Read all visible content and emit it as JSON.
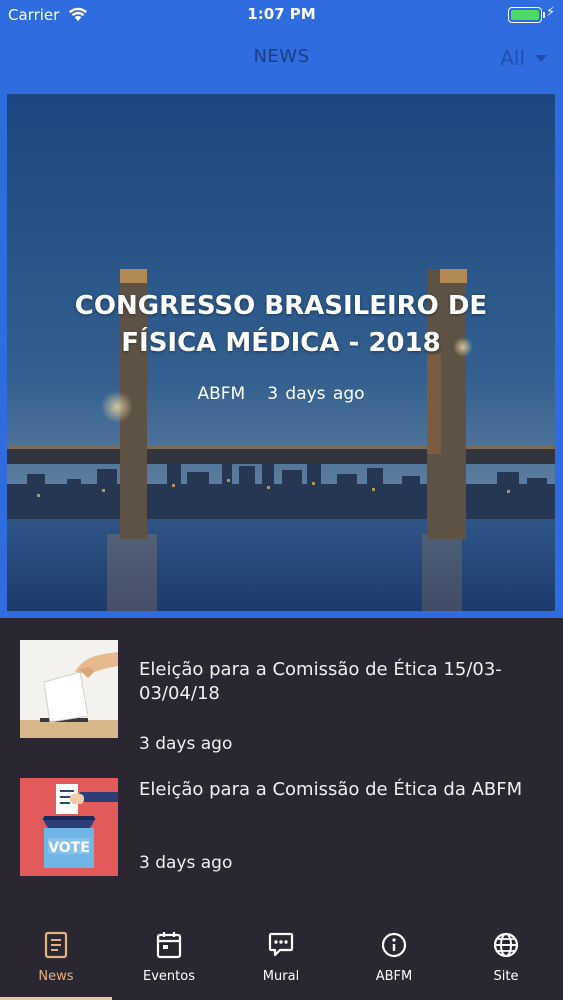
{
  "status": {
    "carrier": "Carrier",
    "time": "1:07 PM"
  },
  "header": {
    "title": "NEWS",
    "filter_label": "All"
  },
  "featured": {
    "title": "CONGRESSO BRASILEIRO DE FÍSICA MÉDICA - 2018",
    "source": "ABFM",
    "time": "3 days ago"
  },
  "news": [
    {
      "title": "Eleição para a Comissão de Ética 15/03-03/04/18",
      "time": "3 days ago",
      "thumb_icon": "ballot-box-icon"
    },
    {
      "title": "Eleição para a Comissão de Ética da ABFM",
      "time": "3 days ago",
      "thumb_icon": "vote-box-icon"
    }
  ],
  "tabs": [
    {
      "label": "News",
      "icon": "news-icon",
      "active": true
    },
    {
      "label": "Eventos",
      "icon": "calendar-icon",
      "active": false
    },
    {
      "label": "Mural",
      "icon": "chat-bubble-icon",
      "active": false
    },
    {
      "label": "ABFM",
      "icon": "info-icon",
      "active": false
    },
    {
      "label": "Site",
      "icon": "globe-icon",
      "active": false
    }
  ],
  "colors": {
    "header_blue": "#2f6ce0",
    "background": "#2a2733",
    "active_tab": "#e3b27f",
    "battery_green": "#4cd964"
  },
  "thumb_text": {
    "vote": "VOTE"
  }
}
